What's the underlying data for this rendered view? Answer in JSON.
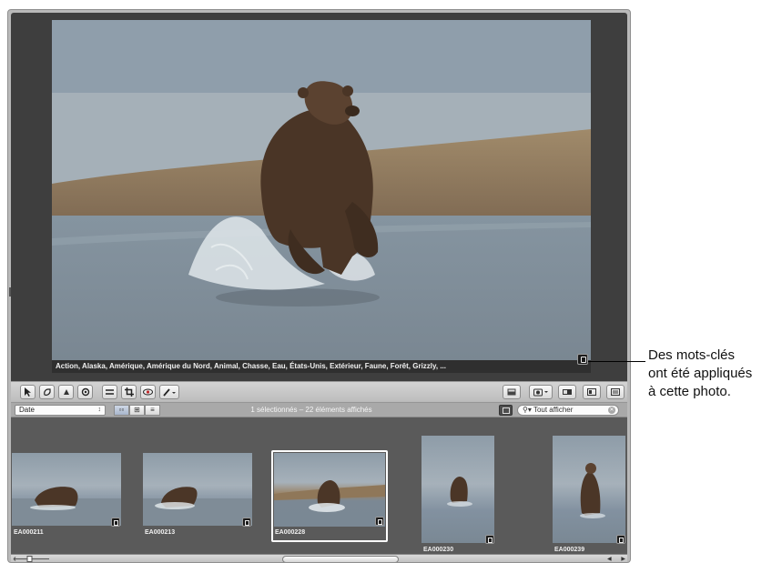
{
  "viewer": {
    "keywords": "Action, Alaska, Amérique, Amérique du Nord, Animal, Chasse, Eau, États-Unis, Extérieur, Faune, Forêt, Grizzly, ..."
  },
  "toolbar": {
    "left_tools": [
      "select-tool-icon",
      "lift-tool-icon",
      "stamp-tool-icon",
      "rotate-tool-icon",
      "straighten-tool-icon",
      "crop-tool-icon",
      "red-eye-tool-icon",
      "brush-tool-icon"
    ],
    "right_tools": [
      "viewer-mode-icon",
      "loupe-icon",
      "stack-icon",
      "split-view-icon",
      "browser-only-icon"
    ]
  },
  "filterbar": {
    "sort_value": "Date",
    "status": "1 sélectionnés – 22 éléments affichés",
    "search_placeholder": "Tout afficher"
  },
  "browser": {
    "thumbnails": [
      {
        "name": "EA000211",
        "selected": false,
        "orientation": "landscape"
      },
      {
        "name": "EA000213",
        "selected": false,
        "orientation": "landscape"
      },
      {
        "name": "EA000228",
        "selected": true,
        "orientation": "landscape"
      },
      {
        "name": "EA000230",
        "selected": false,
        "orientation": "portrait"
      },
      {
        "name": "EA000239",
        "selected": false,
        "orientation": "portrait"
      }
    ]
  },
  "callout": {
    "line1": "Des mots-clés",
    "line2": "ont été appliqués",
    "line3": "à cette photo."
  },
  "colors": {
    "viewer_bg": "#3e3e3e",
    "browser_bg": "#5a5a5a",
    "selection": "#ffffff"
  }
}
